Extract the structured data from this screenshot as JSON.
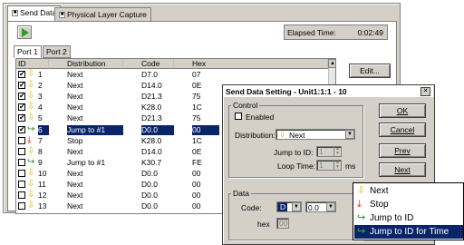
{
  "tabs": [
    {
      "label": "Send Data",
      "active": true
    },
    {
      "label": "Physical Layer Capture",
      "active": false
    }
  ],
  "elapsed": {
    "label": "Elapsed Time:",
    "value": "0:02:49"
  },
  "port_tabs": [
    {
      "label": "Port 1",
      "active": true
    },
    {
      "label": "Port 2",
      "active": false
    }
  ],
  "list": {
    "columns": [
      "ID",
      "Distribution",
      "Code",
      "Hex"
    ],
    "rows": [
      {
        "id": "1",
        "checked": true,
        "icon": "down-arrow-icon",
        "dist": "Next",
        "code": "D7.0",
        "hex": "07"
      },
      {
        "id": "2",
        "checked": true,
        "icon": "down-arrow-icon",
        "dist": "Next",
        "code": "D14.0",
        "hex": "0E"
      },
      {
        "id": "3",
        "checked": true,
        "icon": "down-arrow-icon",
        "dist": "Next",
        "code": "D21.3",
        "hex": "75"
      },
      {
        "id": "4",
        "checked": true,
        "icon": "down-arrow-icon",
        "dist": "Next",
        "code": "K28.0",
        "hex": "1C"
      },
      {
        "id": "5",
        "checked": true,
        "icon": "down-arrow-icon",
        "dist": "Next",
        "code": "D21.3",
        "hex": "75"
      },
      {
        "id": "6",
        "checked": true,
        "icon": "jump-arrow-icon",
        "dist": "Jump to #1",
        "code": "D0.0",
        "hex": "00",
        "selected": true
      },
      {
        "id": "7",
        "checked": false,
        "icon": "stop-icon",
        "dist": "Stop",
        "code": "K28.0",
        "hex": "1C"
      },
      {
        "id": "8",
        "checked": false,
        "icon": "down-arrow-icon",
        "dist": "Next",
        "code": "D14.0",
        "hex": "0E"
      },
      {
        "id": "9",
        "checked": false,
        "icon": "jump-arrow-icon",
        "dist": "Jump to #1",
        "code": "K30.7",
        "hex": "FE"
      },
      {
        "id": "10",
        "checked": false,
        "icon": "down-arrow-icon",
        "dist": "Next",
        "code": "D0.0",
        "hex": "00"
      },
      {
        "id": "11",
        "checked": false,
        "icon": "down-arrow-icon",
        "dist": "Next",
        "code": "D0.0",
        "hex": "00"
      },
      {
        "id": "12",
        "checked": false,
        "icon": "down-arrow-icon",
        "dist": "Next",
        "code": "D0.0",
        "hex": "00"
      },
      {
        "id": "13",
        "checked": false,
        "icon": "down-arrow-icon",
        "dist": "Next",
        "code": "D0.0",
        "hex": "00"
      }
    ]
  },
  "edit_button": "Edit...",
  "dialog": {
    "title": "Send Data Setting - Unit1:1:1 - 10",
    "control_label": "Control",
    "enabled_label": "Enabled",
    "distribution_label": "Distribution:",
    "distribution_value": "Next",
    "jump_to_id_label": "Jump to ID:",
    "jump_to_id_value": "1",
    "loop_time_label": "Loop Time:",
    "loop_time_value": "1",
    "loop_time_unit": "ms",
    "data_label": "Data",
    "code_label": "Code:",
    "code_prefix": "D",
    "code_value": "0.0",
    "hex_label": "hex",
    "hex_value": "00",
    "ok": "OK",
    "cancel": "Cancel",
    "prev": "Prev",
    "next": "Next"
  },
  "popup": {
    "items": [
      {
        "label": "Next",
        "icon": "down-arrow-icon"
      },
      {
        "label": "Stop",
        "icon": "stop-icon"
      },
      {
        "label": "Jump to ID",
        "icon": "jump-arrow-icon"
      },
      {
        "label": "Jump to ID for Time",
        "icon": "jump-time-icon",
        "selected": true
      }
    ]
  },
  "colors": {
    "selection": "#0a246a",
    "down_arrow": "#e8b400",
    "stop": "#d03000",
    "jump": "#2a8a2a",
    "play": "#2aa02a"
  }
}
